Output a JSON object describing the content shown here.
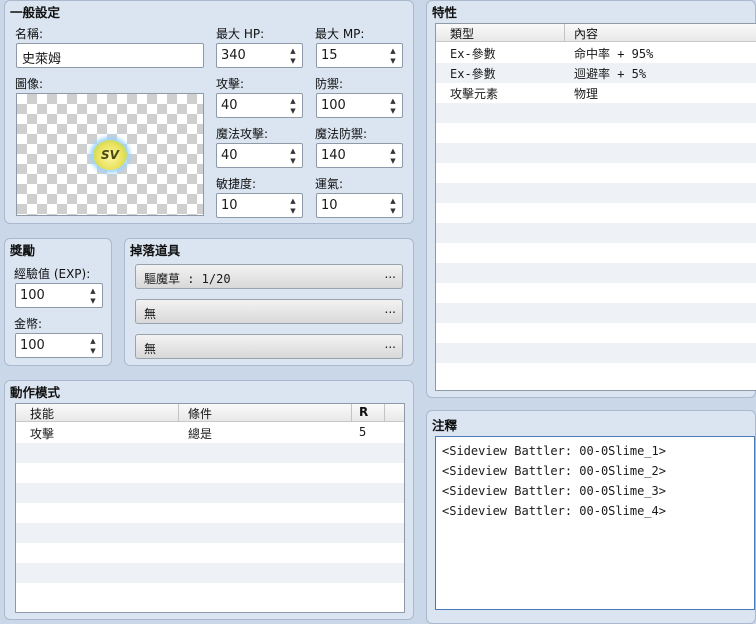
{
  "general": {
    "title": "一般設定",
    "name_label": "名稱:",
    "name_value": "史萊姆",
    "image_label": "圖像:",
    "image_badge": "SV",
    "max_hp_label": "最大 HP:",
    "max_hp": "340",
    "max_mp_label": "最大 MP:",
    "max_mp": "15",
    "atk_label": "攻擊:",
    "atk": "40",
    "def_label": "防禦:",
    "def": "100",
    "mat_label": "魔法攻擊:",
    "mat": "40",
    "mdf_label": "魔法防禦:",
    "mdf": "140",
    "agi_label": "敏捷度:",
    "agi": "10",
    "luk_label": "運氣:",
    "luk": "10"
  },
  "rewards": {
    "title": "獎勵",
    "exp_label": "經驗值 (EXP):",
    "exp": "100",
    "gold_label": "金幣:",
    "gold": "100"
  },
  "drops": {
    "title": "掉落道具",
    "items": [
      "驅魔草 : 1/20",
      "無",
      "無"
    ],
    "more": "..."
  },
  "actions": {
    "title": "動作模式",
    "headers": [
      "技能",
      "條件",
      "R"
    ],
    "rows": [
      {
        "skill": "攻擊",
        "condition": "總是",
        "rating": "5"
      }
    ]
  },
  "traits": {
    "title": "特性",
    "headers": [
      "類型",
      "內容"
    ],
    "rows": [
      {
        "type": "Ex-參數",
        "content": "命中率 + 95%"
      },
      {
        "type": "Ex-參數",
        "content": "迴避率 + 5%"
      },
      {
        "type": "攻擊元素",
        "content": "物理"
      }
    ]
  },
  "note": {
    "title": "注釋",
    "lines": [
      "<Sideview Battler: 00-0Slime_1>",
      "<Sideview Battler: 00-0Slime_2>",
      "<Sideview Battler: 00-0Slime_3>",
      "<Sideview Battler: 00-0Slime_4>"
    ]
  }
}
